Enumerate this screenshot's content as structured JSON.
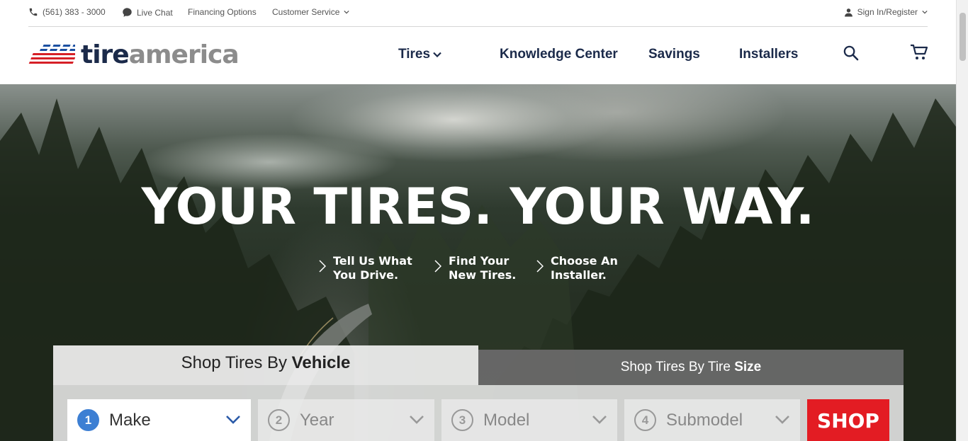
{
  "utility": {
    "phone": "(561) 383 - 3000",
    "live_chat": "Live Chat",
    "financing": "Financing Options",
    "customer_service": "Customer Service",
    "sign_in": "Sign In/Register"
  },
  "header": {
    "logo_tire": "tire",
    "logo_america": "america",
    "nav": {
      "tires": "Tires",
      "knowledge_center": "Knowledge Center",
      "savings": "Savings",
      "installers": "Installers"
    }
  },
  "hero": {
    "title": "YOUR TIRES. YOUR WAY.",
    "steps": [
      {
        "line1": "Tell Us What",
        "line2": "You Drive."
      },
      {
        "line1": "Find Your",
        "line2": "New Tires."
      },
      {
        "line1": "Choose An",
        "line2": "Installer."
      }
    ]
  },
  "shop": {
    "tab_vehicle_prefix": "Shop Tires By",
    "tab_vehicle_bold": "Vehicle",
    "tab_size_prefix": "Shop Tires By Tire",
    "tab_size_bold": "Size",
    "fields": [
      {
        "num": "1",
        "label": "Make"
      },
      {
        "num": "2",
        "label": "Year"
      },
      {
        "num": "3",
        "label": "Model"
      },
      {
        "num": "4",
        "label": "Submodel"
      }
    ],
    "shop_button": "SHOP"
  },
  "colors": {
    "navy": "#1b2a4a",
    "logo_gray": "#8c8c8c",
    "accent_red": "#e31c23",
    "step_blue": "#3d7fd3"
  }
}
